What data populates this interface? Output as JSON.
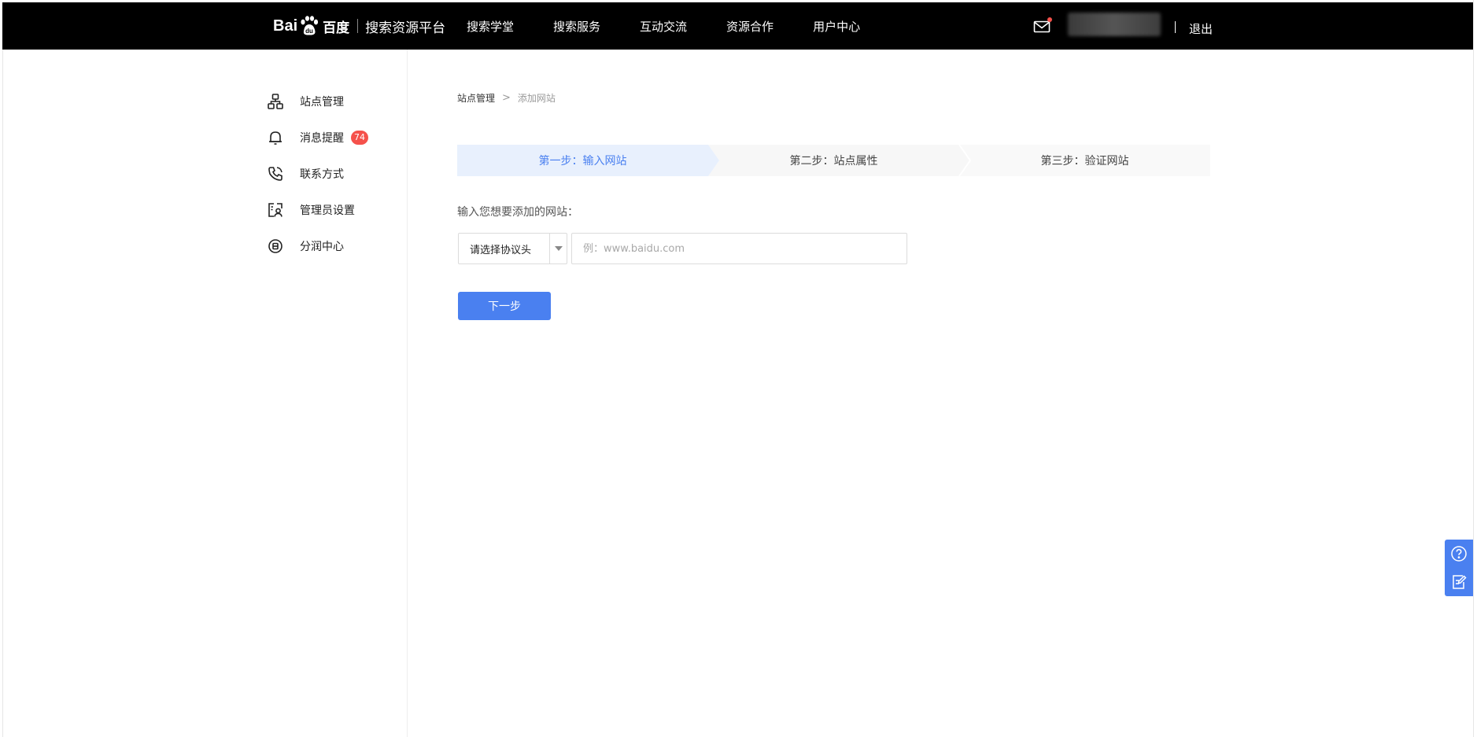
{
  "header": {
    "logo_bai": "Bai",
    "logo_du": "百度",
    "platform_name": "搜索资源平台",
    "nav": [
      {
        "label": "搜索学堂"
      },
      {
        "label": "搜索服务"
      },
      {
        "label": "互动交流"
      },
      {
        "label": "资源合作"
      },
      {
        "label": "用户中心"
      }
    ],
    "logout_label": "退出",
    "icons": {
      "mail": "mail-icon"
    }
  },
  "sidebar": {
    "items": [
      {
        "label": "站点管理",
        "icon": "sitemap-icon"
      },
      {
        "label": "消息提醒",
        "icon": "bell-icon",
        "badge": "74"
      },
      {
        "label": "联系方式",
        "icon": "phone-icon"
      },
      {
        "label": "管理员设置",
        "icon": "admin-card-icon"
      },
      {
        "label": "分润中心",
        "icon": "coin-icon"
      }
    ]
  },
  "main": {
    "breadcrumb": {
      "parent": "站点管理",
      "separator": ">",
      "current": "添加网站"
    },
    "steps": [
      {
        "label": "第一步：输入网站",
        "active": true
      },
      {
        "label": "第二步：站点属性",
        "active": false
      },
      {
        "label": "第三步：验证网站",
        "active": false
      }
    ],
    "prompt": "输入您想要添加的网站：",
    "protocol_select": {
      "value": "请选择协议头"
    },
    "url_input": {
      "value": "",
      "placeholder": "例：www.baidu.com"
    },
    "next_button": "下一步"
  },
  "colors": {
    "accent": "#4a80f0",
    "topbar": "#000000",
    "badge": "#f5514b",
    "active_step_bg": "#e8f0fd",
    "inactive_step_bg": "#f7f7f7"
  }
}
